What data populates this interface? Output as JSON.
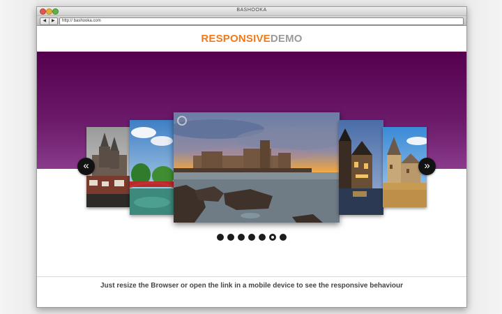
{
  "browser": {
    "window_title": "BASHOOKA",
    "back_glyph": "◀",
    "forward_glyph": "▶",
    "address": "http:// bashooka.com"
  },
  "site": {
    "logo_primary": "RESPONSIVE",
    "logo_secondary": "DEMO",
    "logo_primary_color": "#f07a1a",
    "logo_secondary_color": "#9a9a9a",
    "band_color": "#5e0a5a"
  },
  "carousel": {
    "prev_glyph": "«",
    "next_glyph": "»",
    "dot_count": 7,
    "active_dot": 6,
    "slides": [
      {
        "name": "prague-town-slide"
      },
      {
        "name": "garden-bridge-slide"
      },
      {
        "name": "seaside-fortress-slide"
      },
      {
        "name": "night-castle-slide"
      },
      {
        "name": "riverside-chateau-slide"
      }
    ]
  },
  "footer": {
    "text": "Just resize the Browser or open the link in a mobile device to see the responsive behaviour"
  },
  "icons": [
    "close-icon",
    "minimize-icon",
    "maximize-icon",
    "back-arrow-icon",
    "forward-arrow-icon",
    "play-indicator-icon",
    "double-chevron-left-icon",
    "double-chevron-right-icon"
  ]
}
